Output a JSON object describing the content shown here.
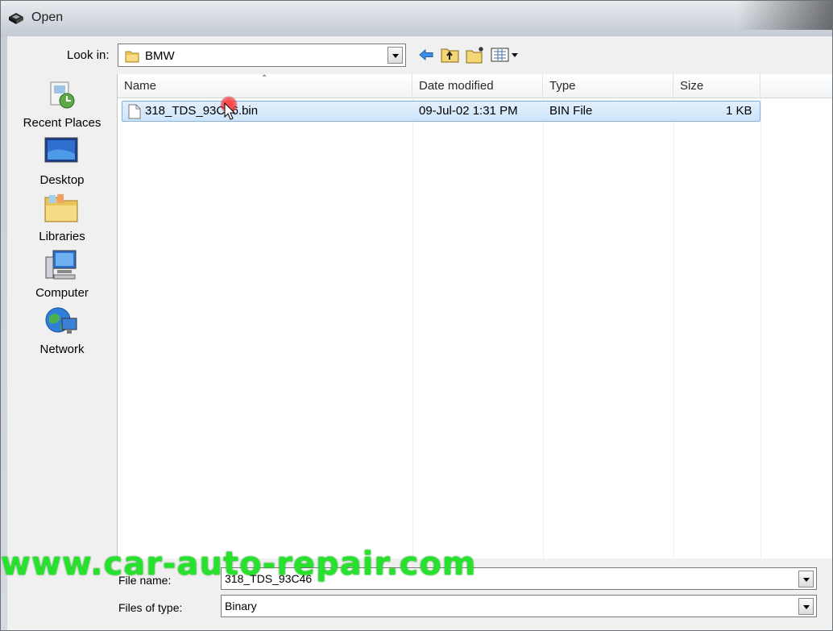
{
  "window": {
    "title": "Open"
  },
  "look_in": {
    "label": "Look in:",
    "value": "BMW"
  },
  "toolbar": {
    "icons": [
      "back-arrow-icon",
      "up-folder-icon",
      "new-folder-icon",
      "view-menu-icon"
    ]
  },
  "places": [
    {
      "label": "Recent Places",
      "icon": "recent-places-icon"
    },
    {
      "label": "Desktop",
      "icon": "desktop-icon"
    },
    {
      "label": "Libraries",
      "icon": "libraries-icon"
    },
    {
      "label": "Computer",
      "icon": "computer-icon"
    },
    {
      "label": "Network",
      "icon": "network-icon"
    }
  ],
  "columns": {
    "name": "Name",
    "date": "Date modified",
    "type": "Type",
    "size": "Size"
  },
  "files": [
    {
      "name": "318_TDS_93C46.bin",
      "date": "09-Jul-02 1:31 PM",
      "type": "BIN File",
      "size": "1 KB",
      "selected": true
    }
  ],
  "file_name": {
    "label": "File name:",
    "value": "318_TDS_93C46"
  },
  "files_of_type": {
    "label": "Files of type:",
    "value": "Binary"
  },
  "watermark": "www.car-auto-repair.com",
  "colors": {
    "selection": "#cde5fb",
    "selection_border": "#7eb4ea",
    "watermark": "#27e22c"
  }
}
